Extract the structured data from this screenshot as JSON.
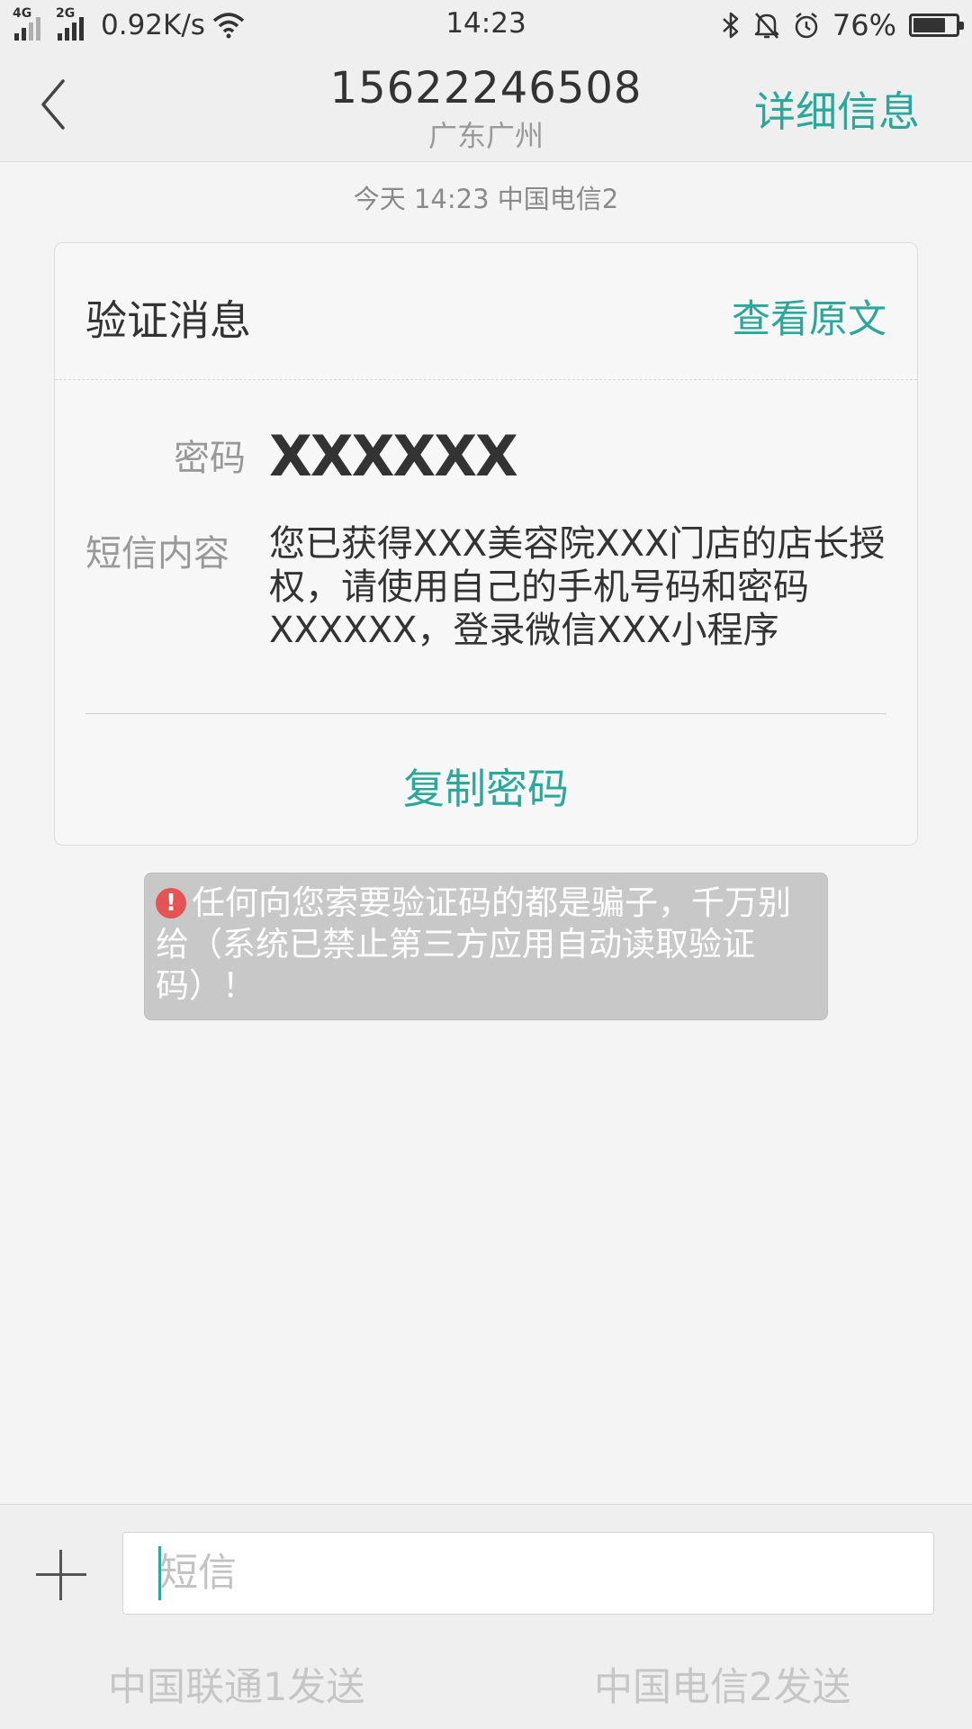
{
  "status_bar": {
    "network1": "4G",
    "network2": "2G",
    "speed": "0.92K/s",
    "time": "14:23",
    "battery": "76%",
    "battery_level": 0.76
  },
  "header": {
    "phone": "15622246508",
    "location": "广东广州",
    "detail_label": "详细信息"
  },
  "timestamp": "今天  14:23  中国电信2",
  "card": {
    "title": "验证消息",
    "view_original": "查看原文",
    "password_label": "密码",
    "password_value": "XXXXXX",
    "content_label": "短信内容",
    "content_text": "您已获得XXX美容院XXX门店的店长授权，请使用自己的手机号码和密码XXXXXX，登录微信XXX小程序",
    "copy_button": "复制密码"
  },
  "warning": {
    "icon": "!",
    "text": "任何向您索要验证码的都是骗子，千万别给（系统已禁止第三方应用自动读取验证码）！"
  },
  "composer": {
    "placeholder": "短信",
    "send_unicom": "中国联通1发送",
    "send_telecom": "中国电信2发送"
  },
  "colors": {
    "accent": "#2aa89a",
    "warning_icon": "#e45454"
  }
}
